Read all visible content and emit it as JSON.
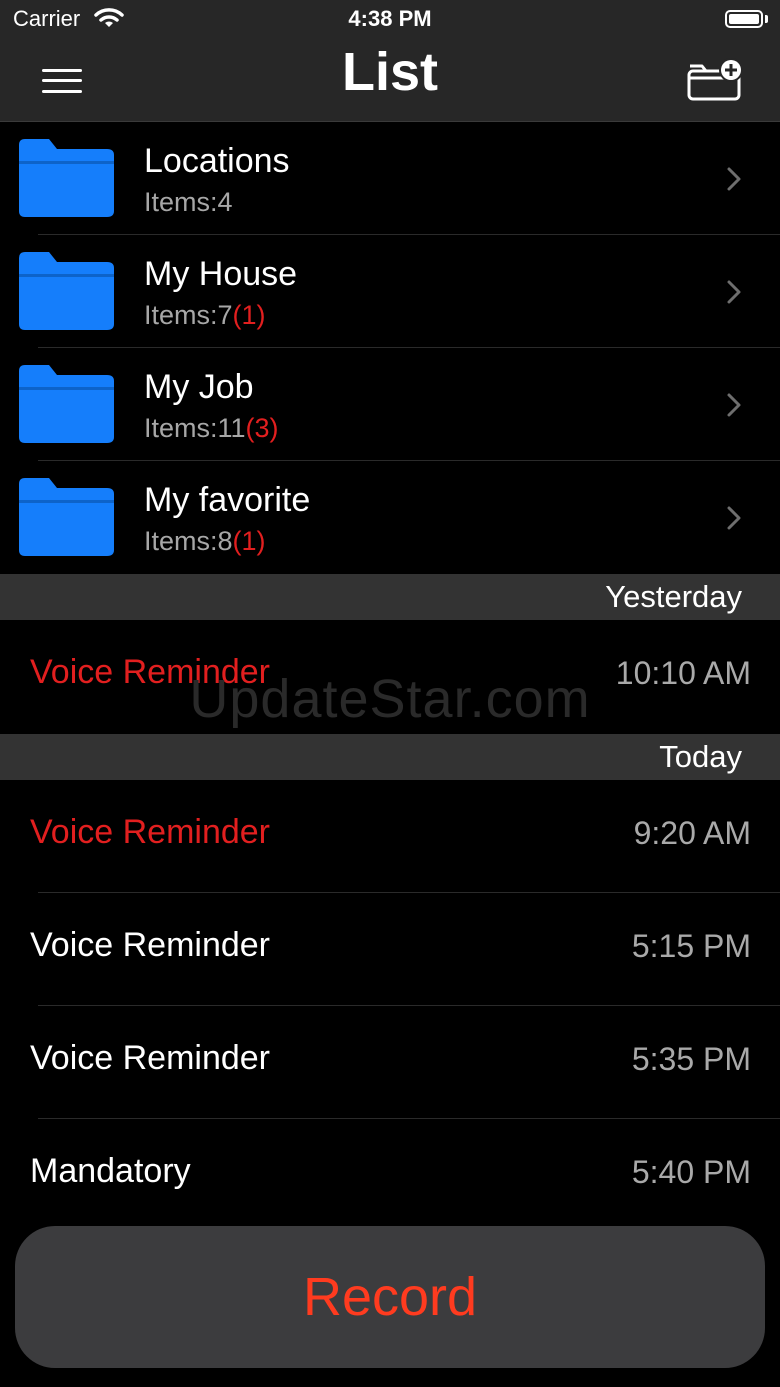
{
  "status_bar": {
    "carrier": "Carrier",
    "time": "4:38 PM"
  },
  "nav": {
    "title": "List"
  },
  "folders": [
    {
      "name": "Locations",
      "count": "Items:4",
      "badge": ""
    },
    {
      "name": "My House",
      "count": "Items:7",
      "badge": "(1)"
    },
    {
      "name": "My Job",
      "count": "Items:11",
      "badge": "(3)"
    },
    {
      "name": "My favorite",
      "count": "Items:8",
      "badge": "(1)"
    }
  ],
  "sections": {
    "yesterday": {
      "header": "Yesterday",
      "items": [
        {
          "name": "Voice Reminder",
          "time": "10:10 AM",
          "highlight": true
        }
      ]
    },
    "today": {
      "header": "Today",
      "items": [
        {
          "name": "Voice Reminder",
          "time": "9:20 AM",
          "highlight": true
        },
        {
          "name": "Voice Reminder",
          "time": "5:15 PM",
          "highlight": false
        },
        {
          "name": "Voice Reminder",
          "time": "5:35 PM",
          "highlight": false
        },
        {
          "name": "Mandatory",
          "time": "5:40 PM",
          "highlight": false
        }
      ]
    }
  },
  "watermark": "UpdateStar.com",
  "record_button": {
    "label": "Record"
  },
  "colors": {
    "folder_blue": "#157efb",
    "alert_red": "#e21f1f",
    "record_red": "#ff3b1f",
    "bar_gray": "#272727",
    "header_gray": "#333333"
  },
  "icons": [
    "wifi-icon",
    "battery-icon",
    "menu-icon",
    "add-folder-icon",
    "folder-icon",
    "chevron-right-icon"
  ]
}
